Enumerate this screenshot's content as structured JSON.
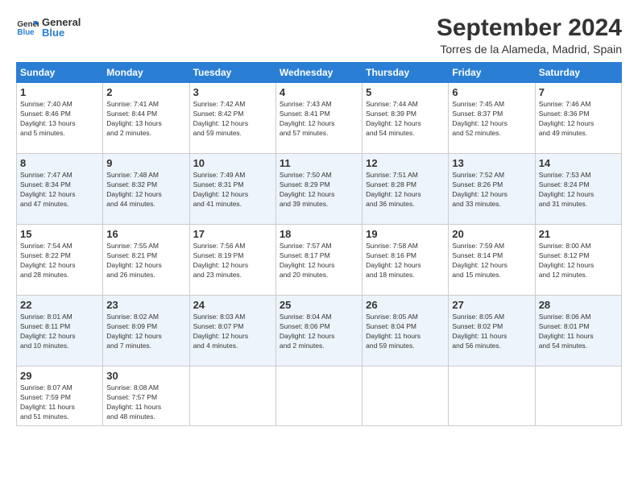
{
  "logo": {
    "line1": "General",
    "line2": "Blue"
  },
  "title": "September 2024",
  "location": "Torres de la Alameda, Madrid, Spain",
  "days_header": [
    "Sunday",
    "Monday",
    "Tuesday",
    "Wednesday",
    "Thursday",
    "Friday",
    "Saturday"
  ],
  "weeks": [
    [
      {
        "day": "1",
        "info": "Sunrise: 7:40 AM\nSunset: 8:46 PM\nDaylight: 13 hours\nand 5 minutes."
      },
      {
        "day": "2",
        "info": "Sunrise: 7:41 AM\nSunset: 8:44 PM\nDaylight: 13 hours\nand 2 minutes."
      },
      {
        "day": "3",
        "info": "Sunrise: 7:42 AM\nSunset: 8:42 PM\nDaylight: 12 hours\nand 59 minutes."
      },
      {
        "day": "4",
        "info": "Sunrise: 7:43 AM\nSunset: 8:41 PM\nDaylight: 12 hours\nand 57 minutes."
      },
      {
        "day": "5",
        "info": "Sunrise: 7:44 AM\nSunset: 8:39 PM\nDaylight: 12 hours\nand 54 minutes."
      },
      {
        "day": "6",
        "info": "Sunrise: 7:45 AM\nSunset: 8:37 PM\nDaylight: 12 hours\nand 52 minutes."
      },
      {
        "day": "7",
        "info": "Sunrise: 7:46 AM\nSunset: 8:36 PM\nDaylight: 12 hours\nand 49 minutes."
      }
    ],
    [
      {
        "day": "8",
        "info": "Sunrise: 7:47 AM\nSunset: 8:34 PM\nDaylight: 12 hours\nand 47 minutes."
      },
      {
        "day": "9",
        "info": "Sunrise: 7:48 AM\nSunset: 8:32 PM\nDaylight: 12 hours\nand 44 minutes."
      },
      {
        "day": "10",
        "info": "Sunrise: 7:49 AM\nSunset: 8:31 PM\nDaylight: 12 hours\nand 41 minutes."
      },
      {
        "day": "11",
        "info": "Sunrise: 7:50 AM\nSunset: 8:29 PM\nDaylight: 12 hours\nand 39 minutes."
      },
      {
        "day": "12",
        "info": "Sunrise: 7:51 AM\nSunset: 8:28 PM\nDaylight: 12 hours\nand 36 minutes."
      },
      {
        "day": "13",
        "info": "Sunrise: 7:52 AM\nSunset: 8:26 PM\nDaylight: 12 hours\nand 33 minutes."
      },
      {
        "day": "14",
        "info": "Sunrise: 7:53 AM\nSunset: 8:24 PM\nDaylight: 12 hours\nand 31 minutes."
      }
    ],
    [
      {
        "day": "15",
        "info": "Sunrise: 7:54 AM\nSunset: 8:22 PM\nDaylight: 12 hours\nand 28 minutes."
      },
      {
        "day": "16",
        "info": "Sunrise: 7:55 AM\nSunset: 8:21 PM\nDaylight: 12 hours\nand 26 minutes."
      },
      {
        "day": "17",
        "info": "Sunrise: 7:56 AM\nSunset: 8:19 PM\nDaylight: 12 hours\nand 23 minutes."
      },
      {
        "day": "18",
        "info": "Sunrise: 7:57 AM\nSunset: 8:17 PM\nDaylight: 12 hours\nand 20 minutes."
      },
      {
        "day": "19",
        "info": "Sunrise: 7:58 AM\nSunset: 8:16 PM\nDaylight: 12 hours\nand 18 minutes."
      },
      {
        "day": "20",
        "info": "Sunrise: 7:59 AM\nSunset: 8:14 PM\nDaylight: 12 hours\nand 15 minutes."
      },
      {
        "day": "21",
        "info": "Sunrise: 8:00 AM\nSunset: 8:12 PM\nDaylight: 12 hours\nand 12 minutes."
      }
    ],
    [
      {
        "day": "22",
        "info": "Sunrise: 8:01 AM\nSunset: 8:11 PM\nDaylight: 12 hours\nand 10 minutes."
      },
      {
        "day": "23",
        "info": "Sunrise: 8:02 AM\nSunset: 8:09 PM\nDaylight: 12 hours\nand 7 minutes."
      },
      {
        "day": "24",
        "info": "Sunrise: 8:03 AM\nSunset: 8:07 PM\nDaylight: 12 hours\nand 4 minutes."
      },
      {
        "day": "25",
        "info": "Sunrise: 8:04 AM\nSunset: 8:06 PM\nDaylight: 12 hours\nand 2 minutes."
      },
      {
        "day": "26",
        "info": "Sunrise: 8:05 AM\nSunset: 8:04 PM\nDaylight: 11 hours\nand 59 minutes."
      },
      {
        "day": "27",
        "info": "Sunrise: 8:05 AM\nSunset: 8:02 PM\nDaylight: 11 hours\nand 56 minutes."
      },
      {
        "day": "28",
        "info": "Sunrise: 8:06 AM\nSunset: 8:01 PM\nDaylight: 11 hours\nand 54 minutes."
      }
    ],
    [
      {
        "day": "29",
        "info": "Sunrise: 8:07 AM\nSunset: 7:59 PM\nDaylight: 11 hours\nand 51 minutes."
      },
      {
        "day": "30",
        "info": "Sunrise: 8:08 AM\nSunset: 7:57 PM\nDaylight: 11 hours\nand 48 minutes."
      },
      null,
      null,
      null,
      null,
      null
    ]
  ]
}
